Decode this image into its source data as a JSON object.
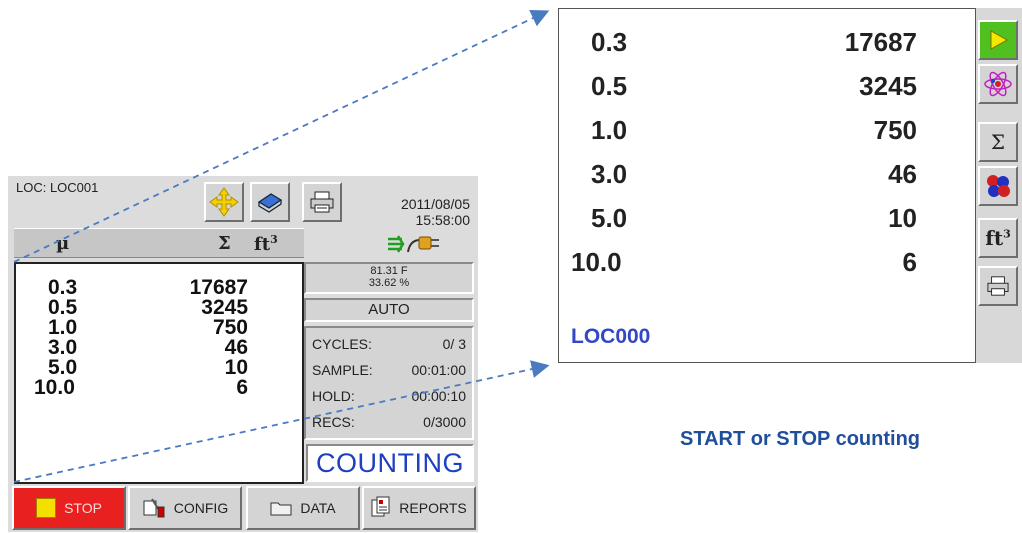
{
  "device": {
    "location": "LOC:  LOC001",
    "date": "2011/08/05",
    "time": "15:58:00",
    "header": {
      "size_col": "µ",
      "sum_col": "Σ",
      "volume_col": "ft",
      "volume_sup": "3"
    },
    "rows": [
      {
        "size": "0.3",
        "count": "17687"
      },
      {
        "size": "0.5",
        "count": "3245"
      },
      {
        "size": "1.0",
        "count": "750"
      },
      {
        "size": "3.0",
        "count": "46"
      },
      {
        "size": "5.0",
        "count": "10"
      },
      {
        "size": "10.0",
        "count": "6"
      }
    ],
    "environment": {
      "temperature": "81.31  F",
      "humidity": "33.62 %"
    },
    "mode": "AUTO",
    "stats": {
      "cycles_label": "CYCLES:",
      "cycles_value": "0/  3",
      "sample_label": "SAMPLE:",
      "sample_value": "00:01:00",
      "hold_label": "HOLD:",
      "hold_value": "00:00:10",
      "recs_label": "RECS:",
      "recs_value": "0/3000"
    },
    "status": "COUNTING",
    "buttons": {
      "stop": "STOP",
      "config": "CONFIG",
      "data": "DATA",
      "reports": "REPORTS"
    },
    "colors": {
      "stop_bg": "#e82020",
      "status_text": "#1e3fc0"
    }
  },
  "zoom": {
    "rows": [
      {
        "size": "0.3",
        "count": "17687"
      },
      {
        "size": "0.5",
        "count": "3245"
      },
      {
        "size": "1.0",
        "count": "750"
      },
      {
        "size": "3.0",
        "count": "46"
      },
      {
        "size": "5.0",
        "count": "10"
      },
      {
        "size": "10.0",
        "count": "6"
      }
    ],
    "location": "LOC000",
    "side_buttons": {
      "sum": "Σ",
      "volume": "ft",
      "volume_sup": "3"
    }
  },
  "caption": "START or STOP counting",
  "icons": [
    "move-arrows-icon",
    "book-icon",
    "printer-icon",
    "connection-plug-icon",
    "play-icon",
    "atom-icon",
    "sigma-icon",
    "particles-icon",
    "cubic-feet-icon",
    "stop-square-icon",
    "tools-icon",
    "folder-icon",
    "reports-icon"
  ]
}
